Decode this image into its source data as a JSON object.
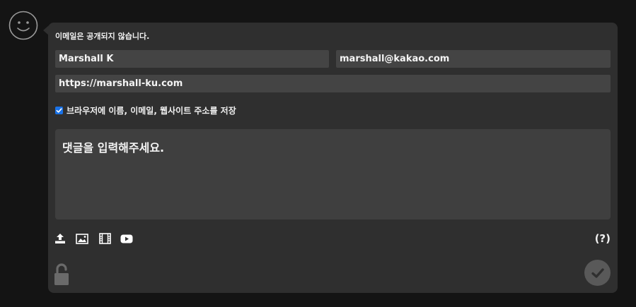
{
  "colors": {
    "background": "#141414",
    "panel": "#2f2f2f",
    "field": "#444444",
    "comment_box": "#3f3f3f",
    "checkbox_accent": "#1a73e8",
    "submit_button": "#595959"
  },
  "avatar": {
    "icon": "smiley-face-icon"
  },
  "form": {
    "email_notice": "이메일은 공개되지 않습니다.",
    "name_value": "Marshall K",
    "email_value": "marshall@kakao.com",
    "website_value": "https://marshall-ku.com",
    "save_info": {
      "checked": true,
      "label": "브라우저에 이름, 이메일, 웹사이트 주소를 저장"
    },
    "comment_placeholder": "댓글을 입력해주세요."
  },
  "toolbar": {
    "icons": [
      "upload-icon",
      "image-icon",
      "video-icon",
      "youtube-icon"
    ],
    "help_label": "(?)"
  },
  "footer": {
    "lock_icon": "unlock-icon",
    "submit_icon": "checkmark-icon"
  }
}
